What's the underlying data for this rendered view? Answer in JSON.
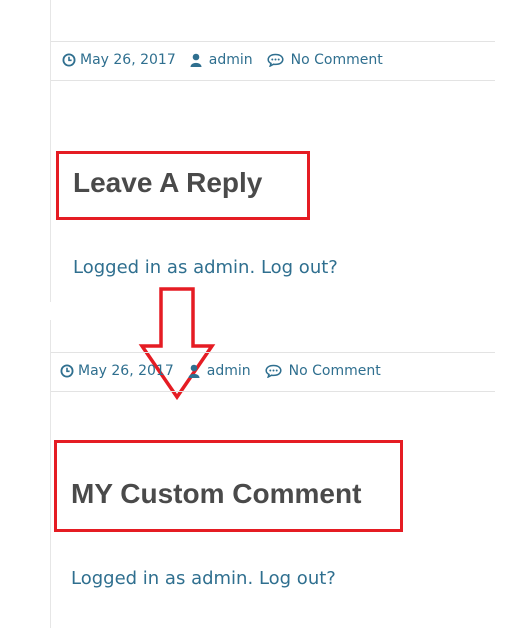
{
  "colors": {
    "accent": "#2f6f8f",
    "heading": "#4a4a4a",
    "highlight": "#e51c23"
  },
  "top_panel": {
    "meta": {
      "date": "May 26, 2017",
      "author": "admin",
      "comments": "No Comment",
      "icons": [
        "clock-icon",
        "user-icon",
        "comment-icon"
      ]
    },
    "heading": "Leave A Reply",
    "logged_in_prefix": "Logged in as ",
    "username": "admin",
    "separator": ".",
    "logout": "Log out?"
  },
  "bottom_panel": {
    "meta": {
      "date": "May 26, 2017",
      "author": "admin",
      "comments": "No Comment",
      "icons": [
        "clock-icon",
        "user-icon",
        "comment-icon"
      ]
    },
    "heading": "MY Custom Comment",
    "logged_in_prefix": "Logged in as ",
    "username": "admin",
    "separator": ".",
    "logout": "Log out?"
  }
}
